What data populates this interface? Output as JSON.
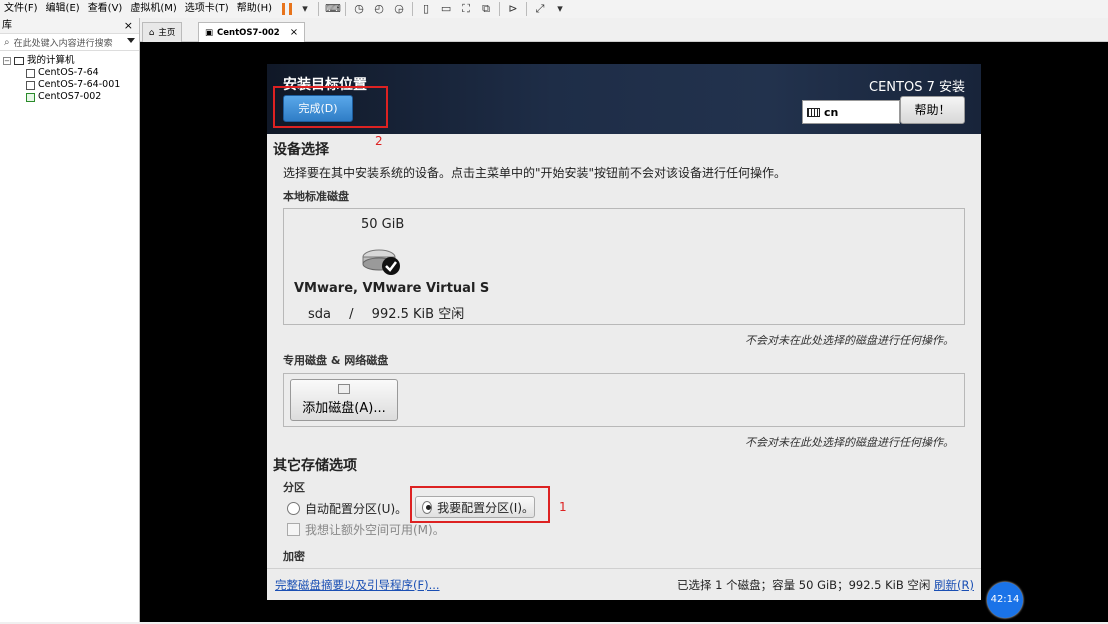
{
  "menubar": {
    "items": [
      "文件(F)",
      "编辑(E)",
      "查看(V)",
      "虚拟机(M)",
      "选项卡(T)",
      "帮助(H)"
    ]
  },
  "sidebar": {
    "title": "库",
    "close": "×",
    "search_placeholder": "在此处键入内容进行搜索",
    "tree": {
      "root": "我的计算机",
      "expander": "−",
      "vms": [
        "CentOS-7-64",
        "CentOS-7-64-001",
        "CentOS7-002"
      ]
    }
  },
  "tabs": {
    "home": "主页",
    "vm": "CentOS7-002",
    "close": "×"
  },
  "installer": {
    "title": "安装目标位置",
    "product": "CENTOS 7 安装",
    "done_button": "完成(D)",
    "keyboard_value": "cn",
    "help_button": "帮助！",
    "device_section": "设备选择",
    "device_desc": "选择要在其中安装系统的设备。点击主菜单中的\"开始安装\"按钮前不会对该设备进行任何操作。",
    "local_disks_title": "本地标准磁盘",
    "disk": {
      "size": "50 GiB",
      "name": "VMware, VMware Virtual S",
      "dev": "sda",
      "sep": "/",
      "free": "992.5 KiB 空闲"
    },
    "untouched_note": "不会对未在此处选择的磁盘进行任何操作。",
    "special_disks_title": "专用磁盘 & 网络磁盘",
    "add_disk_button": "添加磁盘(A)...",
    "other_section": "其它存储选项",
    "partition_title": "分区",
    "auto_partition": "自动配置分区(U)。",
    "manual_partition": "我要配置分区(I)。",
    "extra_space": "我想让额外空间可用(M)。",
    "encryption_title": "加密",
    "footer_link": "完整磁盘摘要以及引导程序(F)...",
    "footer_summary": "已选择 1 个磁盘；容量 50 GiB；992.5 KiB 空闲",
    "refresh": "刷新(R)"
  },
  "annotations": {
    "box1_num": "1",
    "box2_num": "2"
  },
  "timer": "42:14",
  "colors": {
    "accent_blue": "#2f7dc6",
    "annotation_red": "#dd2222",
    "header_dark": "#1e2d47"
  }
}
